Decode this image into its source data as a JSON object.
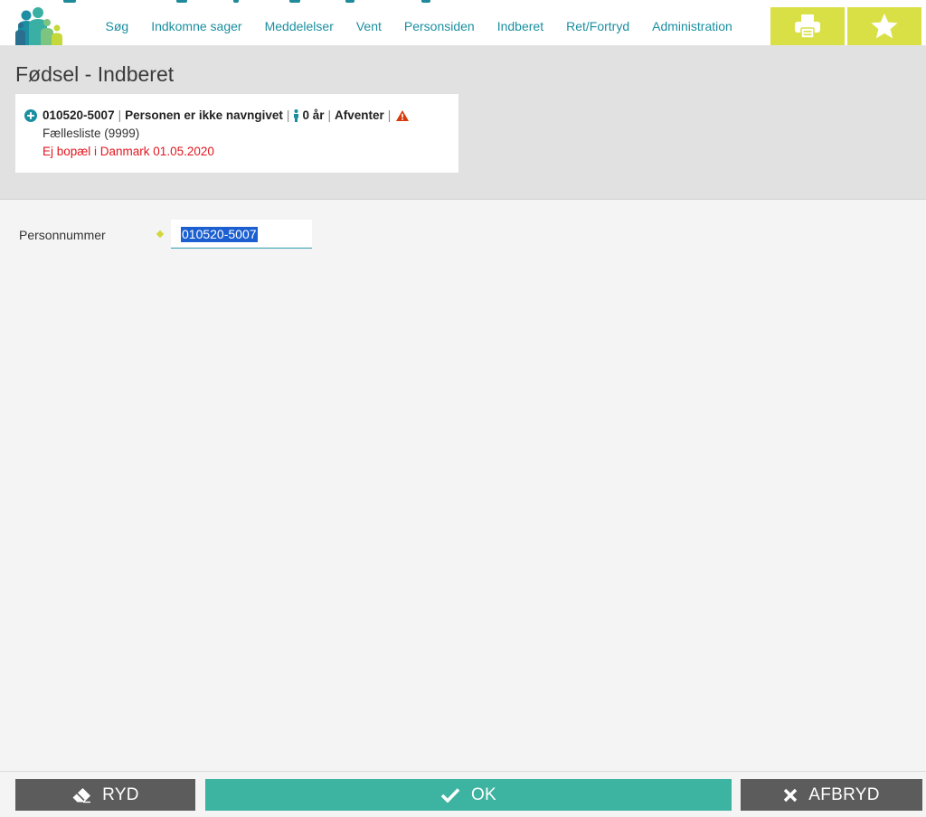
{
  "nav": {
    "items": [
      "Søg",
      "Indkomne sager",
      "Meddelelser",
      "Vent",
      "Personsiden",
      "Indberet",
      "Ret/Fortryd",
      "Administration"
    ],
    "print_icon": "print-icon",
    "favorite_icon": "star-icon"
  },
  "page": {
    "title": "Fødsel - Indberet"
  },
  "person": {
    "cpr": "010520-5007",
    "name": "Personen er ikke navngivet",
    "age": "0 år",
    "status": "Afventer",
    "list": "Fællesliste (9999)",
    "warning": "Ej bopæl i Danmark 01.05.2020"
  },
  "form": {
    "cpr_label": "Personnummer",
    "cpr_value": "010520-5007"
  },
  "footer": {
    "clear_label": "RYD",
    "ok_label": "OK",
    "cancel_label": "AFBRYD"
  },
  "colors": {
    "accent": "#1a8fa0",
    "nav_button": "#d9e046",
    "ok_button": "#3db3a1",
    "dark_button": "#5c5c5c",
    "warning_text": "#e3161e"
  }
}
